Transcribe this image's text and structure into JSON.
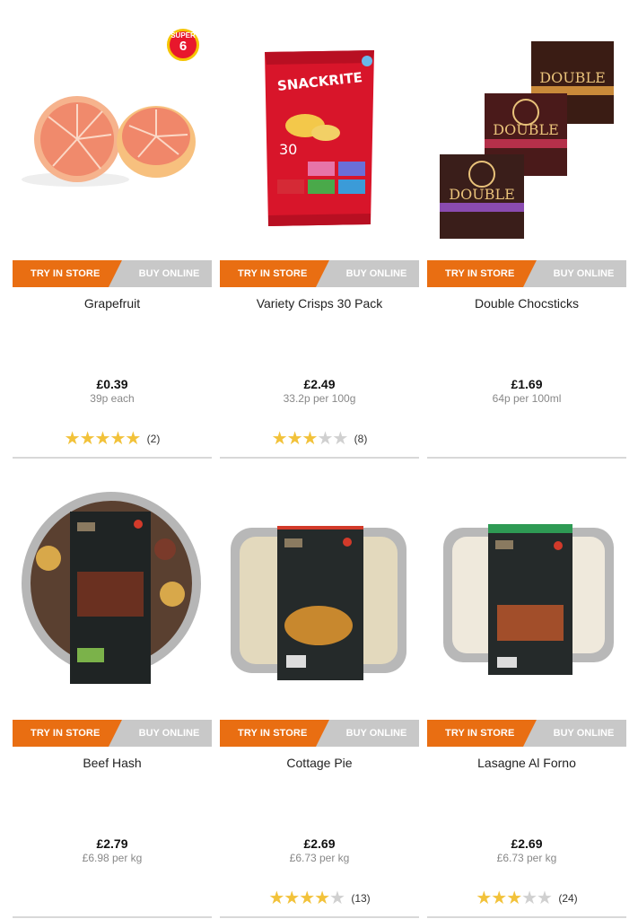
{
  "buttons": {
    "store": "TRY IN STORE",
    "online": "BUY ONLINE"
  },
  "colors": {
    "store": "#e96e12",
    "online": "#c8c8c8",
    "star": "#f2c23a"
  },
  "products": [
    {
      "name": "Grapefruit",
      "price": "£0.39",
      "unit": "39p each",
      "rating": 5,
      "count": "(2)",
      "badge": {
        "top": "SUPER",
        "num": "6"
      },
      "icon": "grapefruit-image"
    },
    {
      "name": "Variety Crisps 30 Pack",
      "price": "£2.49",
      "unit": "33.2p per 100g",
      "rating": 3,
      "count": "(8)",
      "icon": "crisps-bag-image"
    },
    {
      "name": "Double Chocsticks",
      "price": "£1.69",
      "unit": "64p per 100ml",
      "icon": "ice-cream-boxes-image"
    },
    {
      "name": "Beef Hash",
      "price": "£2.79",
      "unit": "£6.98 per kg",
      "icon": "beef-hash-tray-image"
    },
    {
      "name": "Cottage Pie",
      "price": "£2.69",
      "unit": "£6.73 per kg",
      "rating": 4,
      "count": "(13)",
      "icon": "cottage-pie-tray-image"
    },
    {
      "name": "Lasagne Al Forno",
      "price": "£2.69",
      "unit": "£6.73 per kg",
      "rating": 3,
      "count": "(24)",
      "icon": "lasagne-tray-image"
    }
  ]
}
